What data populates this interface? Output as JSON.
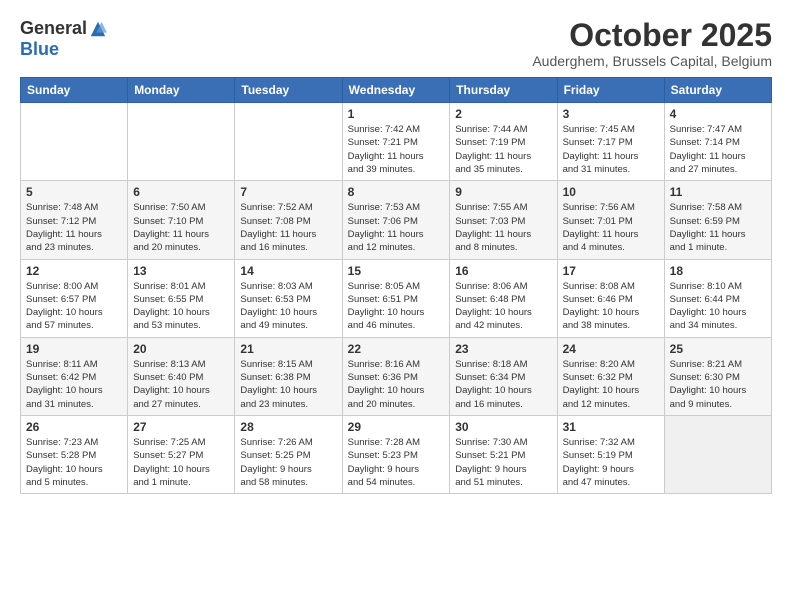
{
  "logo": {
    "general": "General",
    "blue": "Blue"
  },
  "title": "October 2025",
  "location": "Auderghem, Brussels Capital, Belgium",
  "headers": [
    "Sunday",
    "Monday",
    "Tuesday",
    "Wednesday",
    "Thursday",
    "Friday",
    "Saturday"
  ],
  "weeks": [
    [
      {
        "day": "",
        "info": ""
      },
      {
        "day": "",
        "info": ""
      },
      {
        "day": "",
        "info": ""
      },
      {
        "day": "1",
        "info": "Sunrise: 7:42 AM\nSunset: 7:21 PM\nDaylight: 11 hours\nand 39 minutes."
      },
      {
        "day": "2",
        "info": "Sunrise: 7:44 AM\nSunset: 7:19 PM\nDaylight: 11 hours\nand 35 minutes."
      },
      {
        "day": "3",
        "info": "Sunrise: 7:45 AM\nSunset: 7:17 PM\nDaylight: 11 hours\nand 31 minutes."
      },
      {
        "day": "4",
        "info": "Sunrise: 7:47 AM\nSunset: 7:14 PM\nDaylight: 11 hours\nand 27 minutes."
      }
    ],
    [
      {
        "day": "5",
        "info": "Sunrise: 7:48 AM\nSunset: 7:12 PM\nDaylight: 11 hours\nand 23 minutes."
      },
      {
        "day": "6",
        "info": "Sunrise: 7:50 AM\nSunset: 7:10 PM\nDaylight: 11 hours\nand 20 minutes."
      },
      {
        "day": "7",
        "info": "Sunrise: 7:52 AM\nSunset: 7:08 PM\nDaylight: 11 hours\nand 16 minutes."
      },
      {
        "day": "8",
        "info": "Sunrise: 7:53 AM\nSunset: 7:06 PM\nDaylight: 11 hours\nand 12 minutes."
      },
      {
        "day": "9",
        "info": "Sunrise: 7:55 AM\nSunset: 7:03 PM\nDaylight: 11 hours\nand 8 minutes."
      },
      {
        "day": "10",
        "info": "Sunrise: 7:56 AM\nSunset: 7:01 PM\nDaylight: 11 hours\nand 4 minutes."
      },
      {
        "day": "11",
        "info": "Sunrise: 7:58 AM\nSunset: 6:59 PM\nDaylight: 11 hours\nand 1 minute."
      }
    ],
    [
      {
        "day": "12",
        "info": "Sunrise: 8:00 AM\nSunset: 6:57 PM\nDaylight: 10 hours\nand 57 minutes."
      },
      {
        "day": "13",
        "info": "Sunrise: 8:01 AM\nSunset: 6:55 PM\nDaylight: 10 hours\nand 53 minutes."
      },
      {
        "day": "14",
        "info": "Sunrise: 8:03 AM\nSunset: 6:53 PM\nDaylight: 10 hours\nand 49 minutes."
      },
      {
        "day": "15",
        "info": "Sunrise: 8:05 AM\nSunset: 6:51 PM\nDaylight: 10 hours\nand 46 minutes."
      },
      {
        "day": "16",
        "info": "Sunrise: 8:06 AM\nSunset: 6:48 PM\nDaylight: 10 hours\nand 42 minutes."
      },
      {
        "day": "17",
        "info": "Sunrise: 8:08 AM\nSunset: 6:46 PM\nDaylight: 10 hours\nand 38 minutes."
      },
      {
        "day": "18",
        "info": "Sunrise: 8:10 AM\nSunset: 6:44 PM\nDaylight: 10 hours\nand 34 minutes."
      }
    ],
    [
      {
        "day": "19",
        "info": "Sunrise: 8:11 AM\nSunset: 6:42 PM\nDaylight: 10 hours\nand 31 minutes."
      },
      {
        "day": "20",
        "info": "Sunrise: 8:13 AM\nSunset: 6:40 PM\nDaylight: 10 hours\nand 27 minutes."
      },
      {
        "day": "21",
        "info": "Sunrise: 8:15 AM\nSunset: 6:38 PM\nDaylight: 10 hours\nand 23 minutes."
      },
      {
        "day": "22",
        "info": "Sunrise: 8:16 AM\nSunset: 6:36 PM\nDaylight: 10 hours\nand 20 minutes."
      },
      {
        "day": "23",
        "info": "Sunrise: 8:18 AM\nSunset: 6:34 PM\nDaylight: 10 hours\nand 16 minutes."
      },
      {
        "day": "24",
        "info": "Sunrise: 8:20 AM\nSunset: 6:32 PM\nDaylight: 10 hours\nand 12 minutes."
      },
      {
        "day": "25",
        "info": "Sunrise: 8:21 AM\nSunset: 6:30 PM\nDaylight: 10 hours\nand 9 minutes."
      }
    ],
    [
      {
        "day": "26",
        "info": "Sunrise: 7:23 AM\nSunset: 5:28 PM\nDaylight: 10 hours\nand 5 minutes."
      },
      {
        "day": "27",
        "info": "Sunrise: 7:25 AM\nSunset: 5:27 PM\nDaylight: 10 hours\nand 1 minute."
      },
      {
        "day": "28",
        "info": "Sunrise: 7:26 AM\nSunset: 5:25 PM\nDaylight: 9 hours\nand 58 minutes."
      },
      {
        "day": "29",
        "info": "Sunrise: 7:28 AM\nSunset: 5:23 PM\nDaylight: 9 hours\nand 54 minutes."
      },
      {
        "day": "30",
        "info": "Sunrise: 7:30 AM\nSunset: 5:21 PM\nDaylight: 9 hours\nand 51 minutes."
      },
      {
        "day": "31",
        "info": "Sunrise: 7:32 AM\nSunset: 5:19 PM\nDaylight: 9 hours\nand 47 minutes."
      },
      {
        "day": "",
        "info": ""
      }
    ]
  ]
}
